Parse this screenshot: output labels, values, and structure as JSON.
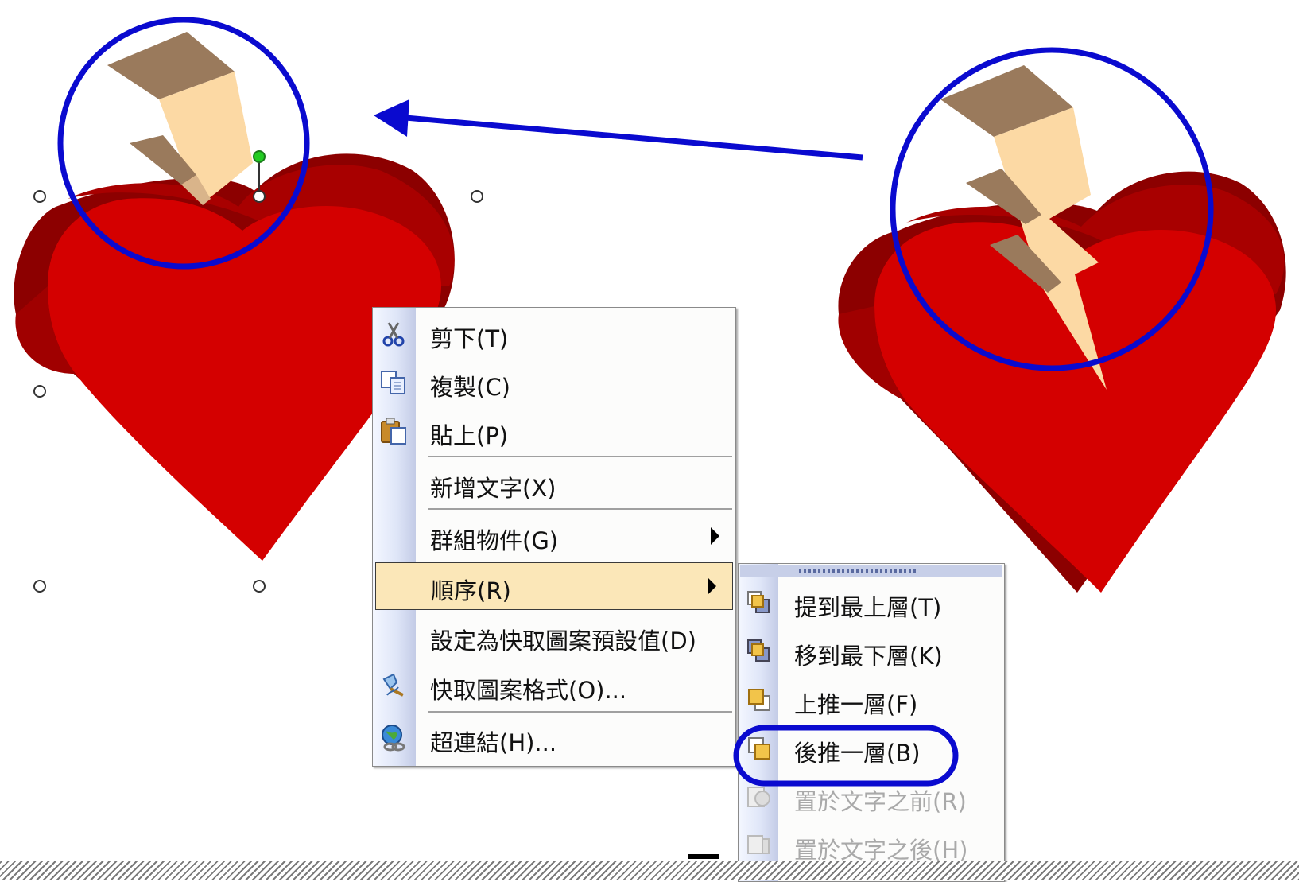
{
  "context_menu": {
    "items": [
      {
        "label": "剪下(T)",
        "icon": "scissors-icon"
      },
      {
        "label": "複製(C)",
        "icon": "copy-icon"
      },
      {
        "label": "貼上(P)",
        "icon": "paste-icon"
      },
      {
        "label": "新增文字(X)"
      },
      {
        "label": "群組物件(G)",
        "submenu": true
      },
      {
        "label": "順序(R)",
        "submenu": true,
        "highlighted": true
      },
      {
        "label": "設定為快取圖案預設值(D)"
      },
      {
        "label": "快取圖案格式(O)...",
        "icon": "format-autoshape-icon"
      },
      {
        "label": "超連結(H)...",
        "icon": "hyperlink-icon"
      }
    ]
  },
  "order_submenu": {
    "items": [
      {
        "label": "提到最上層(T)",
        "icon": "bring-to-front-icon"
      },
      {
        "label": "移到最下層(K)",
        "icon": "send-to-back-icon"
      },
      {
        "label": "上推一層(F)",
        "icon": "bring-forward-icon"
      },
      {
        "label": "後推一層(B)",
        "icon": "send-backward-icon",
        "circled": true
      },
      {
        "label": "置於文字之前(R)",
        "icon": "in-front-of-text-icon",
        "disabled": true
      },
      {
        "label": "置於文字之後(H)",
        "icon": "behind-text-icon",
        "disabled": true
      }
    ]
  },
  "colors": {
    "annotation_blue": "#0a0acf",
    "heart_red": "#d40000",
    "heart_dark": "#8c0000",
    "bolt_light": "#fcd9a4",
    "bolt_top": "#9a7a5c",
    "menu_highlight": "#fbe7b8",
    "selection_handle_green": "#22cc22"
  }
}
